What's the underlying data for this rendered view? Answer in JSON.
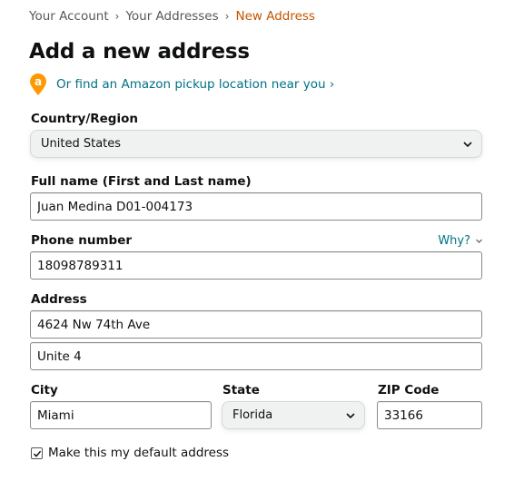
{
  "breadcrumb": {
    "items": [
      "Your Account",
      "Your Addresses",
      "New Address"
    ],
    "separator": "›"
  },
  "page_title": "Add a new address",
  "pickup": {
    "icon": "amazon-location-pin-icon",
    "link_text": "Or find an Amazon pickup location near you ›"
  },
  "country": {
    "label": "Country/Region",
    "value": "United States"
  },
  "full_name": {
    "label": "Full name (First and Last name)",
    "value": "Juan Medina D01-004173"
  },
  "phone": {
    "label": "Phone number",
    "value": "18098789311",
    "help_link": "Why?"
  },
  "address": {
    "label": "Address",
    "line1": "4624 Nw 74th Ave",
    "line2": "Unite 4"
  },
  "city": {
    "label": "City",
    "value": "Miami"
  },
  "state": {
    "label": "State",
    "value": "Florida"
  },
  "zip": {
    "label": "ZIP Code",
    "value": "33166"
  },
  "default_address": {
    "label": "Make this my default address",
    "checked": true
  },
  "colors": {
    "link": "#007185",
    "breadcrumb_current": "#c45500",
    "pin_orange": "#ff9900"
  }
}
